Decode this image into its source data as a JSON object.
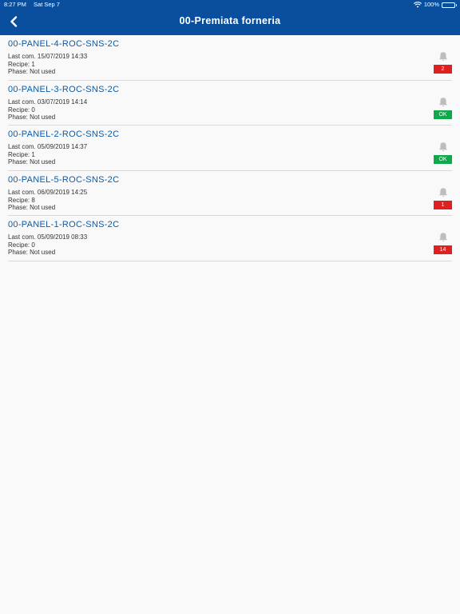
{
  "status_bar": {
    "time": "8:27 PM",
    "date": "Sat Sep 7",
    "battery": "100%",
    "icons": [
      "wifi-icon",
      "battery-icon"
    ]
  },
  "header": {
    "title": "00-Premiata forneria",
    "back_icon": "chevron-left-icon"
  },
  "colors": {
    "header_bg": "#0a4f9e",
    "link_text": "#0a5aa8",
    "alarm_badge": "#e02020",
    "ok_badge": "#0fa84a",
    "bell": "#bdbdbd"
  },
  "panels": [
    {
      "name": "00-PANEL-4-ROC-SNS-2C",
      "last_com": "Last com. 15/07/2019 14:33",
      "recipe": "Recipe: 1",
      "phase": "Phase: Not used",
      "badge": "2",
      "status": "alarm"
    },
    {
      "name": "00-PANEL-3-ROC-SNS-2C",
      "last_com": "Last com. 03/07/2019 14:14",
      "recipe": "Recipe: 0",
      "phase": "Phase: Not used",
      "badge": "OK",
      "status": "ok"
    },
    {
      "name": "00-PANEL-2-ROC-SNS-2C",
      "last_com": "Last com. 05/09/2019 14:37",
      "recipe": "Recipe: 1",
      "phase": "Phase: Not used",
      "badge": "OK",
      "status": "ok"
    },
    {
      "name": "00-PANEL-5-ROC-SNS-2C",
      "last_com": "Last com. 06/09/2019 14:25",
      "recipe": "Recipe: 8",
      "phase": "Phase: Not used",
      "badge": "1",
      "status": "alarm"
    },
    {
      "name": "00-PANEL-1-ROC-SNS-2C",
      "last_com": "Last com. 05/09/2019 08:33",
      "recipe": "Recipe: 0",
      "phase": "Phase: Not used",
      "badge": "14",
      "status": "alarm"
    }
  ]
}
